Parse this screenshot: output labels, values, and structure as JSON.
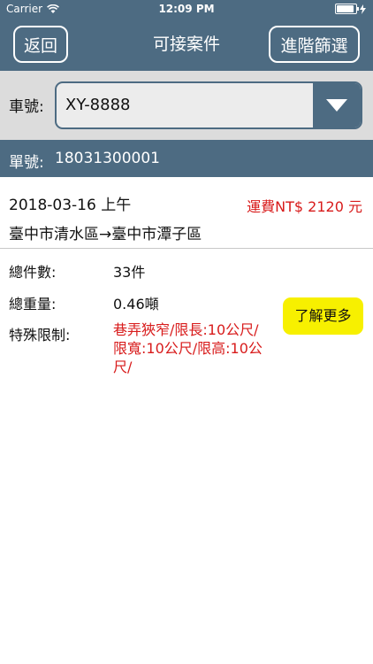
{
  "status_bar": {
    "carrier": "Carrier",
    "time": "12:09 PM"
  },
  "nav": {
    "back_label": "返回",
    "title": "可接案件",
    "filter_label": "進階篩選"
  },
  "vehicle": {
    "label": "車號:",
    "selected": "XY-8888"
  },
  "order": {
    "label": "單號:",
    "number": "18031300001"
  },
  "case": {
    "date": "2018-03-16 上午",
    "fee": "運費NT$ 2120 元",
    "route": "臺中市清水區→臺中市潭子區",
    "total_count_label": "總件數:",
    "total_count": "33件",
    "total_weight_label": "總重量:",
    "total_weight": "0.46噸",
    "restriction_label": "特殊限制:",
    "restriction": "巷弄狹窄/限長:10公尺/限寬:10公尺/限高:10公尺/",
    "more_button": "了解更多"
  },
  "colors": {
    "header": "#4d6b82",
    "accent_red": "#d81b1b",
    "more_button": "#f7f000"
  }
}
